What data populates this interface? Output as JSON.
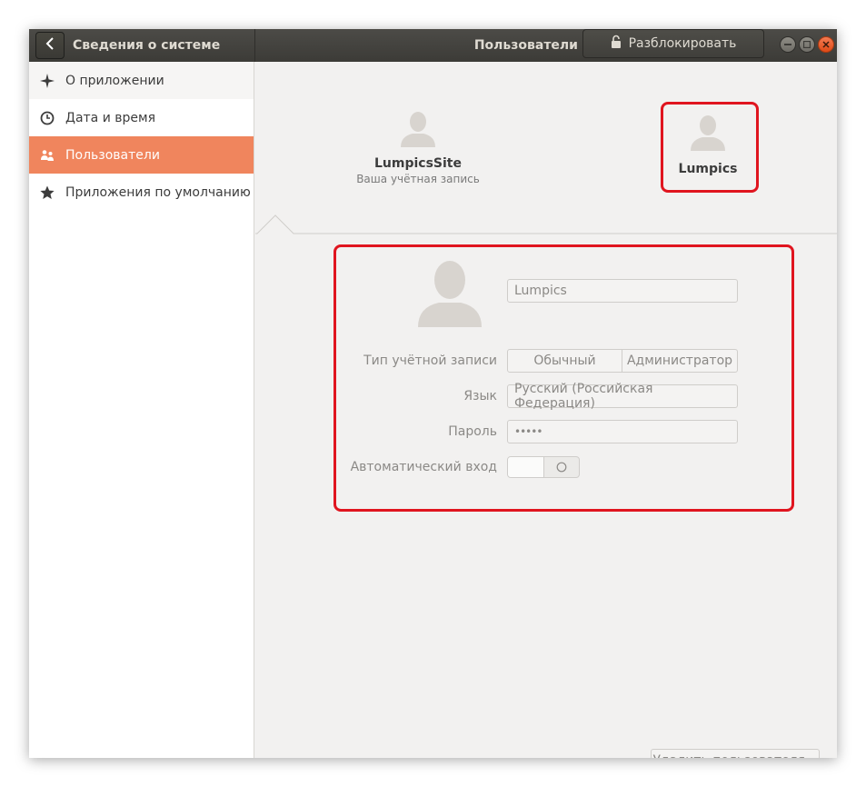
{
  "titlebar": {
    "section_title": "Сведения о системе",
    "panel_title": "Пользователи",
    "unlock_label": "Разблокировать"
  },
  "sidebar": {
    "items": [
      {
        "label": "О приложении",
        "icon": "sparkle-icon"
      },
      {
        "label": "Дата и время",
        "icon": "clock-icon"
      },
      {
        "label": "Пользователи",
        "icon": "users-icon"
      },
      {
        "label": "Приложения по умолчанию",
        "icon": "star-icon"
      }
    ],
    "active_index": 2
  },
  "users": {
    "list": [
      {
        "name": "LumpicsSite",
        "subtitle": "Ваша учётная запись"
      },
      {
        "name": "Lumpics",
        "subtitle": ""
      }
    ],
    "selected_index": 1
  },
  "details": {
    "name_value": "Lumpics",
    "account_type_label": "Тип учётной записи",
    "account_type_options": [
      "Обычный",
      "Администратор"
    ],
    "language_label": "Язык",
    "language_value": "Русский (Российская Федерация)",
    "password_label": "Пароль",
    "password_value": "•••••",
    "autologin_label": "Автоматический вход",
    "autologin_on": false
  },
  "actions": {
    "delete_label": "Удалить пользователя..."
  },
  "colors": {
    "accent": "#f0855d",
    "titlebar": "#3c3b37",
    "highlight_red": "#e0151f",
    "close": "#df4a16"
  }
}
